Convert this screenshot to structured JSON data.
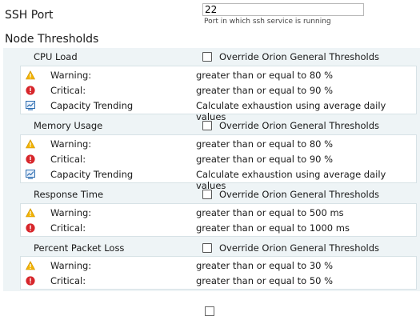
{
  "ssh": {
    "label": "SSH Port",
    "value": "22",
    "help": "Port in which ssh service is running"
  },
  "thresholds_title": "Node Thresholds",
  "override_label": "Override Orion General Thresholds",
  "sections": {
    "cpu": {
      "title": "CPU Load",
      "warning_label": "Warning:",
      "warning_value": "greater than or equal to 80 %",
      "critical_label": "Critical:",
      "critical_value": "greater than or equal to 90 %",
      "trend_label": "Capacity Trending",
      "trend_value": "Calculate exhaustion using average daily values"
    },
    "memory": {
      "title": "Memory Usage",
      "warning_label": "Warning:",
      "warning_value": "greater than or equal to 80 %",
      "critical_label": "Critical:",
      "critical_value": "greater than or equal to 90 %",
      "trend_label": "Capacity Trending",
      "trend_value": "Calculate exhaustion using average daily values"
    },
    "response": {
      "title": "Response Time",
      "warning_label": "Warning:",
      "warning_value": "greater than or equal to 500 ms",
      "critical_label": "Critical:",
      "critical_value": "greater than or equal to 1000 ms"
    },
    "packet_loss": {
      "title": "Percent Packet Loss",
      "warning_label": "Warning:",
      "warning_value": "greater than or equal to 30 %",
      "critical_label": "Critical:",
      "critical_value": "greater than or equal to 50 %"
    }
  },
  "icons": {
    "warning": "warning-triangle-icon",
    "critical": "critical-circle-icon",
    "trend": "capacity-trend-icon"
  },
  "colors": {
    "warning": "#f4b400",
    "critical": "#d7262b",
    "trend": "#2b6cb0",
    "panel_bg": "#eef4f6"
  }
}
